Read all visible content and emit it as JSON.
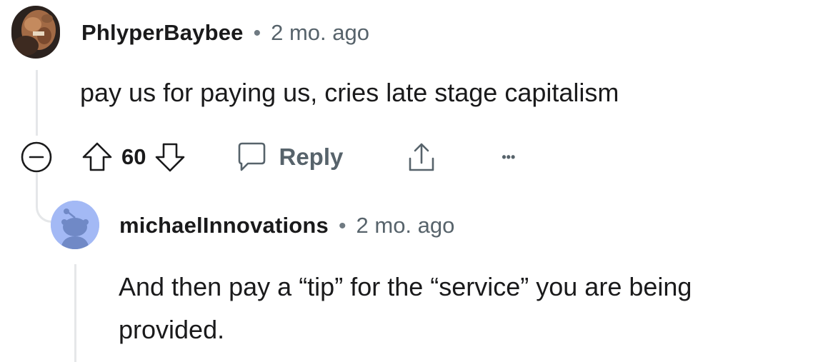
{
  "comment": {
    "author": "PhlyperBaybee",
    "separator": "•",
    "time": "2 mo. ago",
    "body": "pay us for paying us, cries late stage capitalism",
    "votes": "60",
    "reply_label": "Reply",
    "more_label": "•••",
    "icons": {
      "collapse": "collapse-icon",
      "upvote": "upvote-icon",
      "downvote": "downvote-icon",
      "reply": "comment-bubble-icon",
      "share": "share-icon"
    }
  },
  "reply": {
    "author": "michaelInnovations",
    "separator": "•",
    "time": "2 mo. ago",
    "body_line1": "And then pay a “tip” for the “service” you are being",
    "body_line2": "provided."
  },
  "colors": {
    "text": "#1a1a1b",
    "meta": "#57636b",
    "thread_line": "#e5e7e9",
    "reply_avatar_bg": "#a3b9f5",
    "reply_avatar_snoo": "#7089c6"
  }
}
